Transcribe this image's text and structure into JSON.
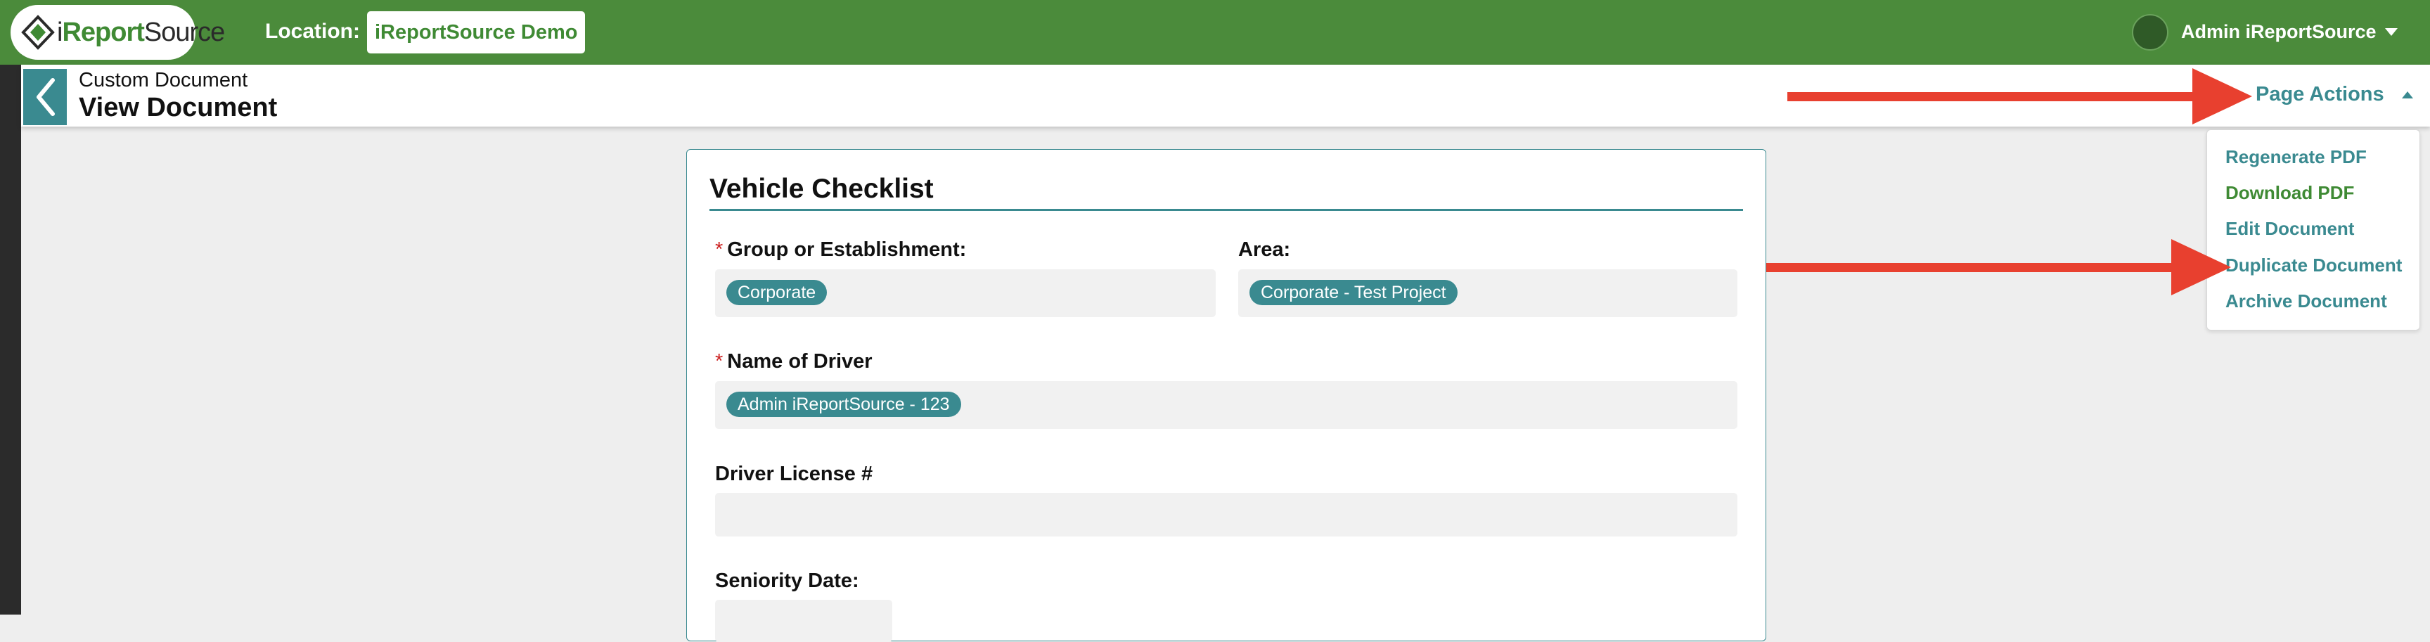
{
  "header": {
    "logo": {
      "text_prefix": "i",
      "text_brand": "Report",
      "text_suffix": "Source"
    },
    "location_label": "Location:",
    "location_value": "iReportSource Demo",
    "user_name": "Admin iReportSource"
  },
  "subheader": {
    "section": "Custom Document",
    "title": "View Document",
    "page_actions_label": "Page Actions"
  },
  "page_actions_menu": {
    "items": [
      {
        "label": "Regenerate PDF",
        "color": "#3a8a90"
      },
      {
        "label": "Download PDF",
        "color": "#3f8a34"
      },
      {
        "label": "Edit Document",
        "color": "#3a8a90"
      },
      {
        "label": "Duplicate Document",
        "color": "#3a8a90"
      },
      {
        "label": "Archive Document",
        "color": "#3a8a90"
      }
    ]
  },
  "form": {
    "title": "Vehicle Checklist",
    "fields": {
      "group": {
        "label": "Group or Establishment:",
        "required": true,
        "value": "Corporate"
      },
      "area": {
        "label": "Area:",
        "required": false,
        "value": "Corporate - Test Project"
      },
      "driver": {
        "label": "Name of Driver",
        "required": true,
        "value": "Admin iReportSource - 123"
      },
      "license": {
        "label": "Driver License #",
        "required": false,
        "value": ""
      },
      "seniority": {
        "label": "Seniority Date:",
        "required": false,
        "value": ""
      }
    }
  },
  "colors": {
    "brand_green": "#4b8b3b",
    "accent_teal": "#3a8a90",
    "annotation_red": "#e8402f"
  }
}
